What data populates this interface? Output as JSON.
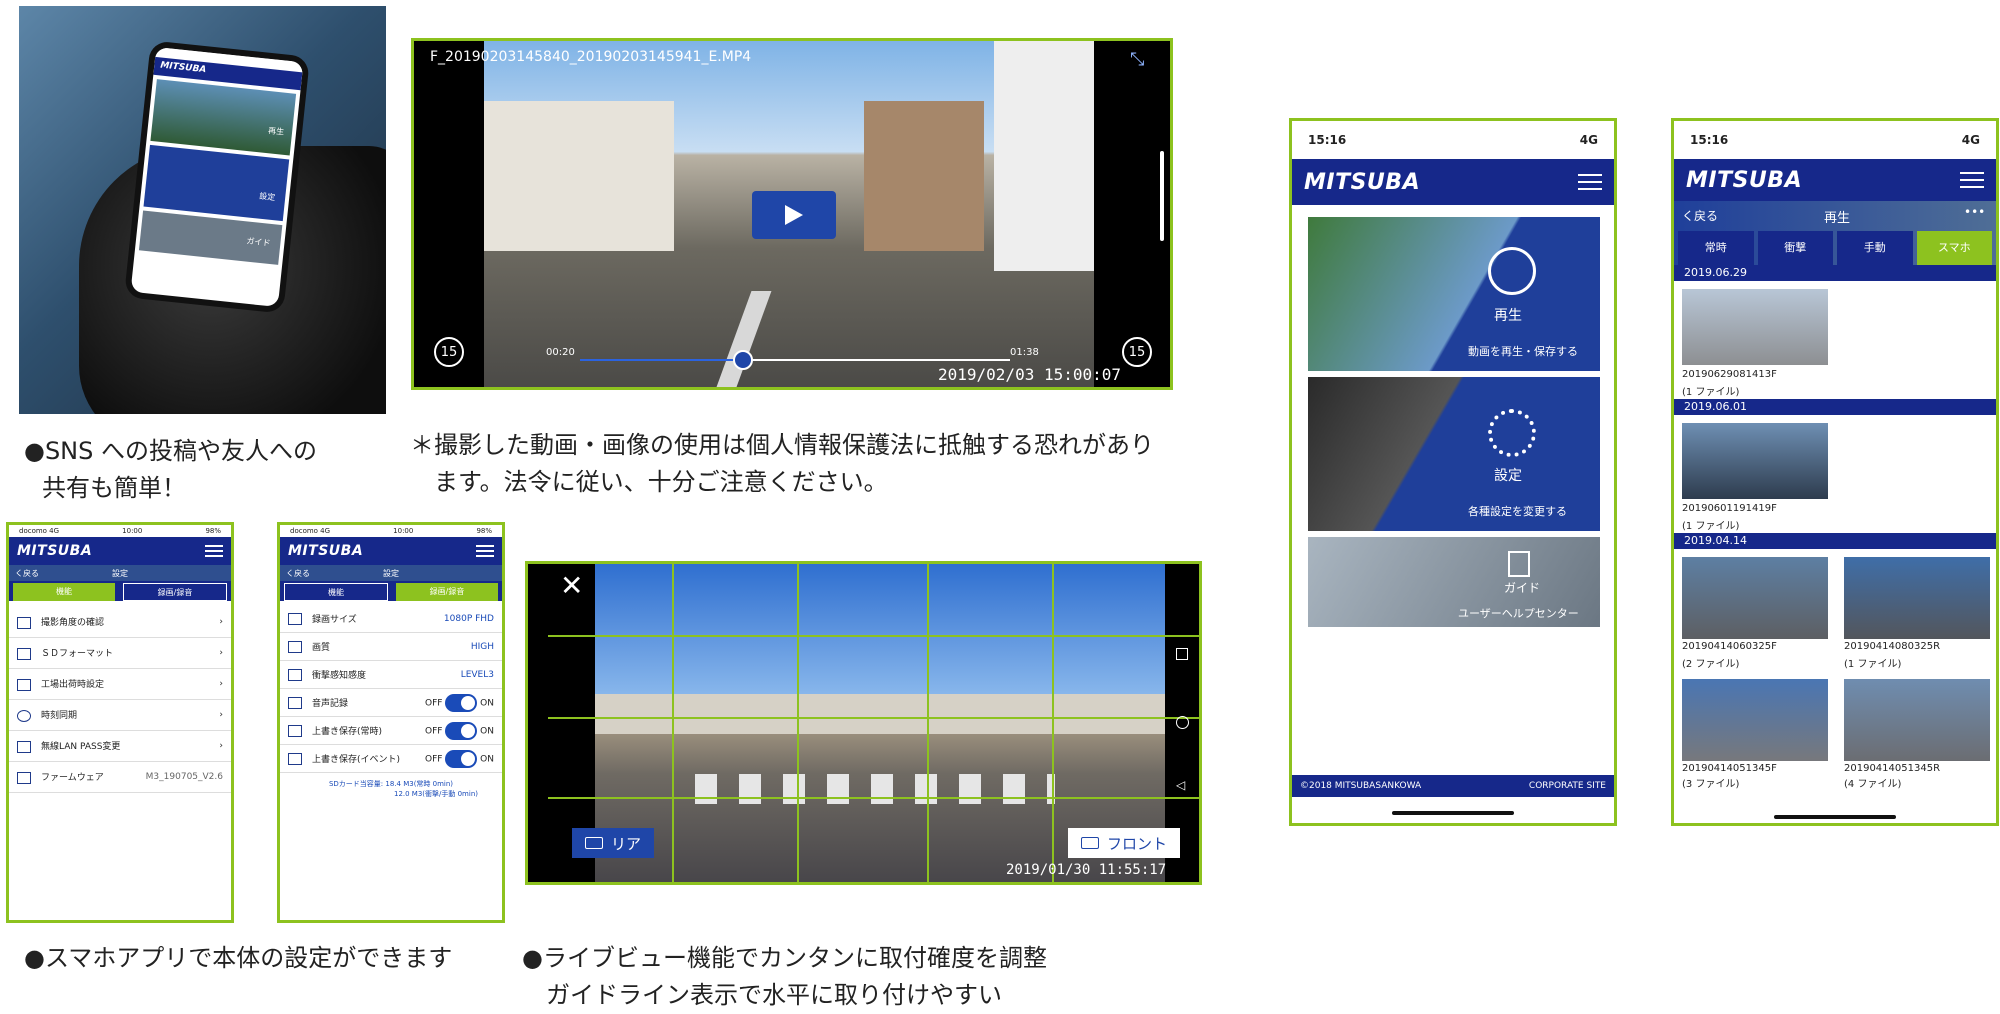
{
  "photo_phone": {
    "brand": "MITSUBA",
    "tile1": "再生",
    "tile2": "設定",
    "tile3": "ガイド"
  },
  "video": {
    "filename": "F_20190203145840_20190203145941_E.MP4",
    "time_current": "00:20",
    "time_total": "01:38",
    "timestamp": "2019/02/03 15:00:07",
    "skip_back": "15",
    "skip_fwd": "15",
    "progress": 0.38
  },
  "captions": {
    "sns_line1": "●SNS への投稿や友人への",
    "sns_line2": "共有も簡単！",
    "notice_line1": "＊撮影した動画・画像の使用は個人情報保護法に抵触する恐れがあり",
    "notice_line2": "ます。法令に従い、十分ご注意ください。",
    "settings": "●スマホアプリで本体の設定ができます",
    "liveview_line1": "●ライブビュー機能でカンタンに取付確度を調整",
    "liveview_line2": "ガイドライン表示で水平に取り付けやすい"
  },
  "settings_left": {
    "carrier": "docomo 4G",
    "time": "10:00",
    "battery": "98%",
    "brand": "MITSUBA",
    "back": "く戻る",
    "header_title": "設定",
    "tab_active": "機能",
    "tab_other": "録画/録音",
    "rows": [
      {
        "label": "撮影角度の確認",
        "value": ""
      },
      {
        "label": "ＳＤフォーマット",
        "value": ""
      },
      {
        "label": "工場出荷時設定",
        "value": ""
      },
      {
        "label": "時刻同期",
        "value": ""
      },
      {
        "label": "無線LAN PASS変更",
        "value": ""
      },
      {
        "label": "ファームウェア",
        "value": "M3_190705_V2.6"
      }
    ]
  },
  "settings_right": {
    "carrier": "docomo 4G",
    "time": "10:00",
    "battery": "98%",
    "brand": "MITSUBA",
    "back": "く戻る",
    "header_title": "設定",
    "tab_other": "機能",
    "tab_active": "録画/録音",
    "rows": [
      {
        "label": "録画サイズ",
        "value": "1080P FHD",
        "type": "select"
      },
      {
        "label": "画質",
        "value": "HIGH",
        "type": "select"
      },
      {
        "label": "衝撃感知感度",
        "value": "LEVEL3",
        "type": "select"
      },
      {
        "label": "音声記録",
        "off": "OFF",
        "on": "ON",
        "type": "toggle"
      },
      {
        "label": "上書き保存(常時)",
        "off": "OFF",
        "on": "ON",
        "type": "toggle"
      },
      {
        "label": "上書き保存(イベント)",
        "off": "OFF",
        "on": "ON",
        "type": "toggle"
      }
    ],
    "sd_line1": "SDカード当容量: 18.4 M3(常時 0min)",
    "sd_line2": "12.0 M3(衝撃/手動 0min)"
  },
  "liveview": {
    "rear_label": "リア",
    "front_label": "フロント",
    "timestamp": "2019/01/30 11:55:17"
  },
  "home_phone": {
    "time": "15:16",
    "network": "4G",
    "brand": "MITSUBA",
    "play_title": "再生",
    "play_sub": "動画を再生・保存する",
    "settings_title": "設定",
    "settings_sub": "各種設定を変更する",
    "guide_title": "ガイド",
    "guide_sub": "ユーザーヘルプセンター",
    "copyright": "©2018 MITSUBASANKOWA",
    "corporate": "CORPORATE SITE"
  },
  "playback_phone": {
    "time": "15:16",
    "network": "4G",
    "brand": "MITSUBA",
    "back": "く戻る",
    "title": "再生",
    "more": "•••",
    "tabs": [
      "常時",
      "衝撃",
      "手動",
      "スマホ"
    ],
    "active_tab": "スマホ",
    "groups": [
      {
        "date": "2019.06.29",
        "items": [
          {
            "name": "20190629081413F",
            "count": "(1 ファイル)"
          }
        ]
      },
      {
        "date": "2019.06.01",
        "items": [
          {
            "name": "20190601191419F",
            "count": "(1 ファイル)"
          }
        ]
      },
      {
        "date": "2019.04.14",
        "items": [
          {
            "name": "20190414060325F",
            "count": "(2 ファイル)"
          },
          {
            "name": "20190414080325R",
            "count": "(1 ファイル)"
          },
          {
            "name": "20190414051345F",
            "count": "(3 ファイル)"
          },
          {
            "name": "20190414051345R",
            "count": "(4 ファイル)"
          }
        ]
      }
    ]
  },
  "colors": {
    "frame_green": "#8dc21f",
    "brand_navy": "#16288a",
    "accent_green": "#8dc21f",
    "toggle_blue": "#1a4bb8"
  }
}
